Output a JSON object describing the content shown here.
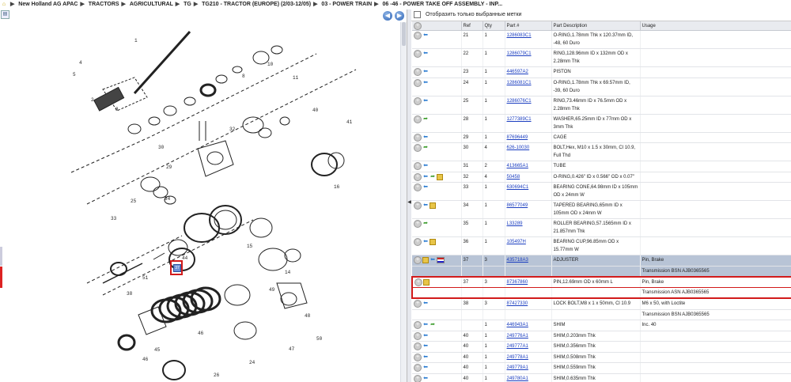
{
  "breadcrumb": {
    "items": [
      "New Holland AG APAC",
      "TRACTORS",
      "AGRICULTURAL",
      "TG",
      "TG210 - TRACTOR (EUROPE) (2/03-12/05)",
      "03 - POWER TRAIN",
      "06 -46 - POWER TAKE OFF ASSEMBLY - INP..."
    ]
  },
  "toolbar": {
    "filter_label": "Отобразить только выбранные метки"
  },
  "diagram": {
    "callout_ref": "37"
  },
  "table": {
    "headers": [
      "",
      "Ref",
      "Qty",
      "Part #",
      "Part Description",
      "Usage"
    ],
    "rows": [
      {
        "ref": "21",
        "qty": "1",
        "part": "1286083C1",
        "desc": "O-RING,1.78mm Thk x 120.37mm ID, -48, 60 Duro",
        "usage": ""
      },
      {
        "ref": "22",
        "qty": "1",
        "part": "1286079C1",
        "desc": "RING,128.96mm ID x 132mm OD x 2.28mm Thk",
        "usage": ""
      },
      {
        "ref": "23",
        "qty": "1",
        "part": "446597A2",
        "desc": "PISTON",
        "usage": ""
      },
      {
        "ref": "24",
        "qty": "1",
        "part": "1286081C1",
        "desc": "O-RING,1.78mm Thk x 69.57mm ID, -39, 60 Duro",
        "usage": ""
      },
      {
        "ref": "25",
        "qty": "1",
        "part": "1286076C1",
        "desc": "RING,73.46mm ID x 76.5mm OD x 2.28mm Thk",
        "usage": ""
      },
      {
        "ref": "28",
        "qty": "1",
        "part": "1277389C1",
        "desc": "WASHER,65.25mm ID x 77mm OD x 3mm Thk",
        "usage": ""
      },
      {
        "ref": "29",
        "qty": "1",
        "part": "87696449",
        "desc": "CAGE",
        "usage": ""
      },
      {
        "ref": "30",
        "qty": "4",
        "part": "626-10030",
        "desc": "BOLT,Hex, M10 x 1.5 x 30mm, Cl 10.9, Full Thd",
        "usage": ""
      },
      {
        "ref": "31",
        "qty": "2",
        "part": "413665A1",
        "desc": "TUBE",
        "usage": ""
      },
      {
        "ref": "32",
        "qty": "4",
        "part": "50458",
        "desc": "O-RING,0.426\" ID x 0.566\" OD x 0.07\"",
        "usage": ""
      },
      {
        "ref": "33",
        "qty": "1",
        "part": "630694C1",
        "desc": "BEARING CONE,64.98mm ID x 105mm OD x 24mm W",
        "usage": ""
      },
      {
        "ref": "34",
        "qty": "1",
        "part": "86577049",
        "desc": "TAPERED BEARING,65mm ID x 105mm OD x 24mm W",
        "usage": ""
      },
      {
        "ref": "35",
        "qty": "1",
        "part": "L33289",
        "desc": "ROLLER BEARING,57.1565mm ID x 21.857mm Thk",
        "usage": ""
      },
      {
        "ref": "36",
        "qty": "1",
        "part": "105497H",
        "desc": "BEARING CUP,96.85mm OD x 15.77mm W",
        "usage": ""
      },
      {
        "ref": "37",
        "qty": "3",
        "part": "435718A3",
        "desc": "ADJUSTER",
        "usage": "Pin, Brake"
      },
      {
        "ref": "",
        "qty": "",
        "part": "",
        "desc": "",
        "usage": "Transmission BSN AJB0365565"
      },
      {
        "ref": "37",
        "qty": "3",
        "part": "87367860",
        "desc": "PIN,12.69mm OD x 60mm L",
        "usage": "Pin, Brake"
      },
      {
        "ref": "",
        "qty": "",
        "part": "",
        "desc": "",
        "usage": "Transmission ASN AJB0365565"
      },
      {
        "ref": "38",
        "qty": "3",
        "part": "87427330",
        "desc": "LOCK BOLT,M8 x 1 x 50mm, Cl 10.9",
        "usage": "M6 x 50, with Loctite"
      },
      {
        "ref": "",
        "qty": "",
        "part": "",
        "desc": "",
        "usage": "Transmission BSN AJB0365565"
      },
      {
        "ref": "",
        "qty": "1",
        "part": "446943A1",
        "desc": "SHIM",
        "usage": "Inc. 40"
      },
      {
        "ref": "40",
        "qty": "1",
        "part": "249776A1",
        "desc": "SHIM,0.203mm Thk",
        "usage": ""
      },
      {
        "ref": "40",
        "qty": "1",
        "part": "249777A1",
        "desc": "SHIM,0.356mm Thk",
        "usage": ""
      },
      {
        "ref": "40",
        "qty": "1",
        "part": "249778A1",
        "desc": "SHIM,0.508mm Thk",
        "usage": ""
      },
      {
        "ref": "40",
        "qty": "1",
        "part": "249779A1",
        "desc": "SHIM,0.559mm Thk",
        "usage": ""
      },
      {
        "ref": "40",
        "qty": "1",
        "part": "249780A1",
        "desc": "SHIM,0.635mm Thk",
        "usage": ""
      },
      {
        "ref": "41",
        "qty": "1",
        "part": "87427329",
        "desc": "SPACER,57.55mm ID x 72mm OD x",
        "usage": ""
      }
    ]
  },
  "colors": {
    "accent_red": "#d21b1b",
    "link_blue": "#1a3dc0",
    "selected_row": "#b8c4d6"
  },
  "icons": [
    "home-icon",
    "back-arrow-icon",
    "forward-arrow-icon",
    "expand-icon",
    "revision-icon",
    "new-part-icon",
    "kit-icon",
    "flag-icon"
  ]
}
